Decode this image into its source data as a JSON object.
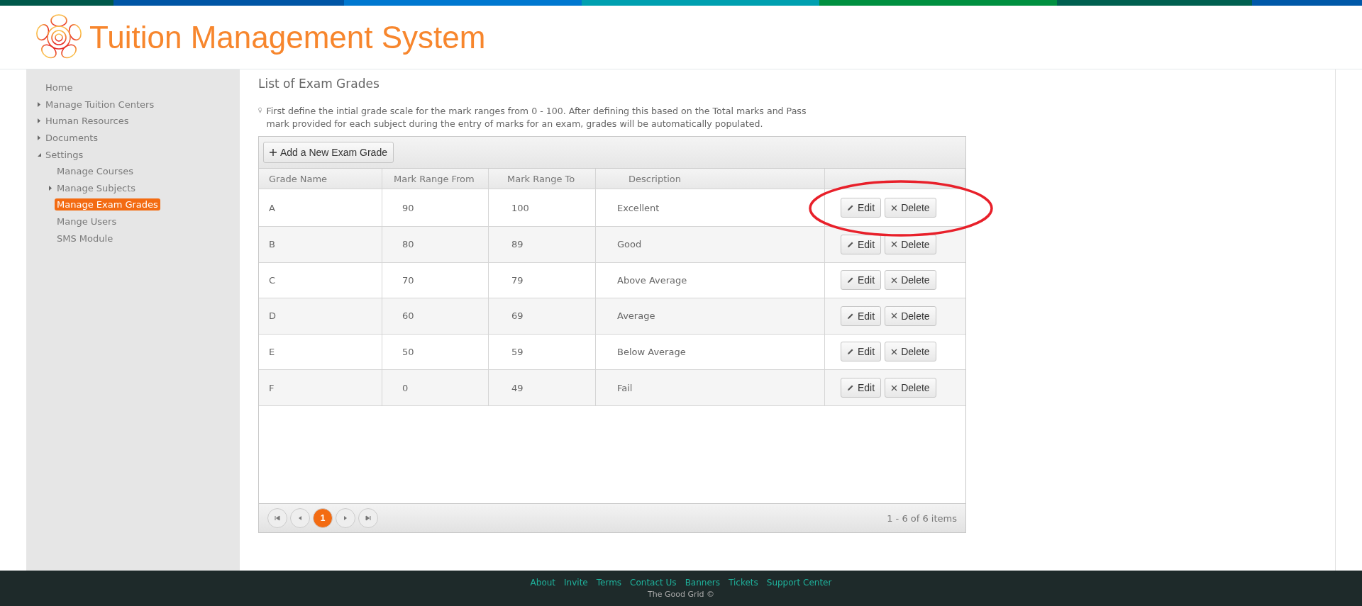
{
  "header": {
    "title": "Tuition Management System"
  },
  "sidebar": {
    "items": [
      {
        "label": "Home",
        "selected": false
      },
      {
        "label": "Manage Tuition Centers",
        "expanded": false,
        "selected": false
      },
      {
        "label": "Human Resources",
        "expanded": false,
        "selected": false
      },
      {
        "label": "Documents",
        "expanded": false,
        "selected": false
      },
      {
        "label": "Settings",
        "expanded": true,
        "selected": false,
        "children": [
          {
            "label": "Manage Courses",
            "selected": false
          },
          {
            "label": "Manage Subjects",
            "expanded": false,
            "selected": false
          },
          {
            "label": "Manage Exam Grades",
            "selected": true
          },
          {
            "label": "Mange Users",
            "selected": false
          },
          {
            "label": "SMS Module",
            "selected": false
          }
        ]
      }
    ]
  },
  "page_title": "List of Exam Grades",
  "hint": "First define the intial grade scale for the mark ranges from 0 - 100. After defining this based on the Total marks and Pass mark provided for each subject during the entry of marks for an exam, grades will be automatically populated.",
  "toolbar": {
    "add_button": "Add a New Exam Grade"
  },
  "table": {
    "columns": [
      "Grade Name",
      "Mark Range From",
      "Mark Range To",
      "Description"
    ],
    "rows": [
      {
        "grade": "A",
        "from": "90",
        "to": "100",
        "description": "Excellent",
        "edit": "Edit",
        "delete": "Delete",
        "highlighted": true
      },
      {
        "grade": "B",
        "from": "80",
        "to": "89",
        "description": "Good",
        "edit": "Edit",
        "delete": "Delete",
        "highlighted": false
      },
      {
        "grade": "C",
        "from": "70",
        "to": "79",
        "description": "Above Average",
        "edit": "Edit",
        "delete": "Delete",
        "highlighted": false
      },
      {
        "grade": "D",
        "from": "60",
        "to": "69",
        "description": "Average",
        "edit": "Edit",
        "delete": "Delete",
        "highlighted": false
      },
      {
        "grade": "E",
        "from": "50",
        "to": "59",
        "description": "Below Average",
        "edit": "Edit",
        "delete": "Delete",
        "highlighted": false
      },
      {
        "grade": "F",
        "from": "0",
        "to": "49",
        "description": "Fail",
        "edit": "Edit",
        "delete": "Delete",
        "highlighted": false
      }
    ]
  },
  "pager": {
    "pages": [
      {
        "label": "1",
        "selected": true
      }
    ],
    "summary": "1 - 6 of 6 items"
  },
  "footer": {
    "links": [
      "About",
      "Invite",
      "Terms",
      "Contact Us",
      "Banners",
      "Tickets",
      "Support Center"
    ],
    "copyright": "The Good Grid ©"
  }
}
